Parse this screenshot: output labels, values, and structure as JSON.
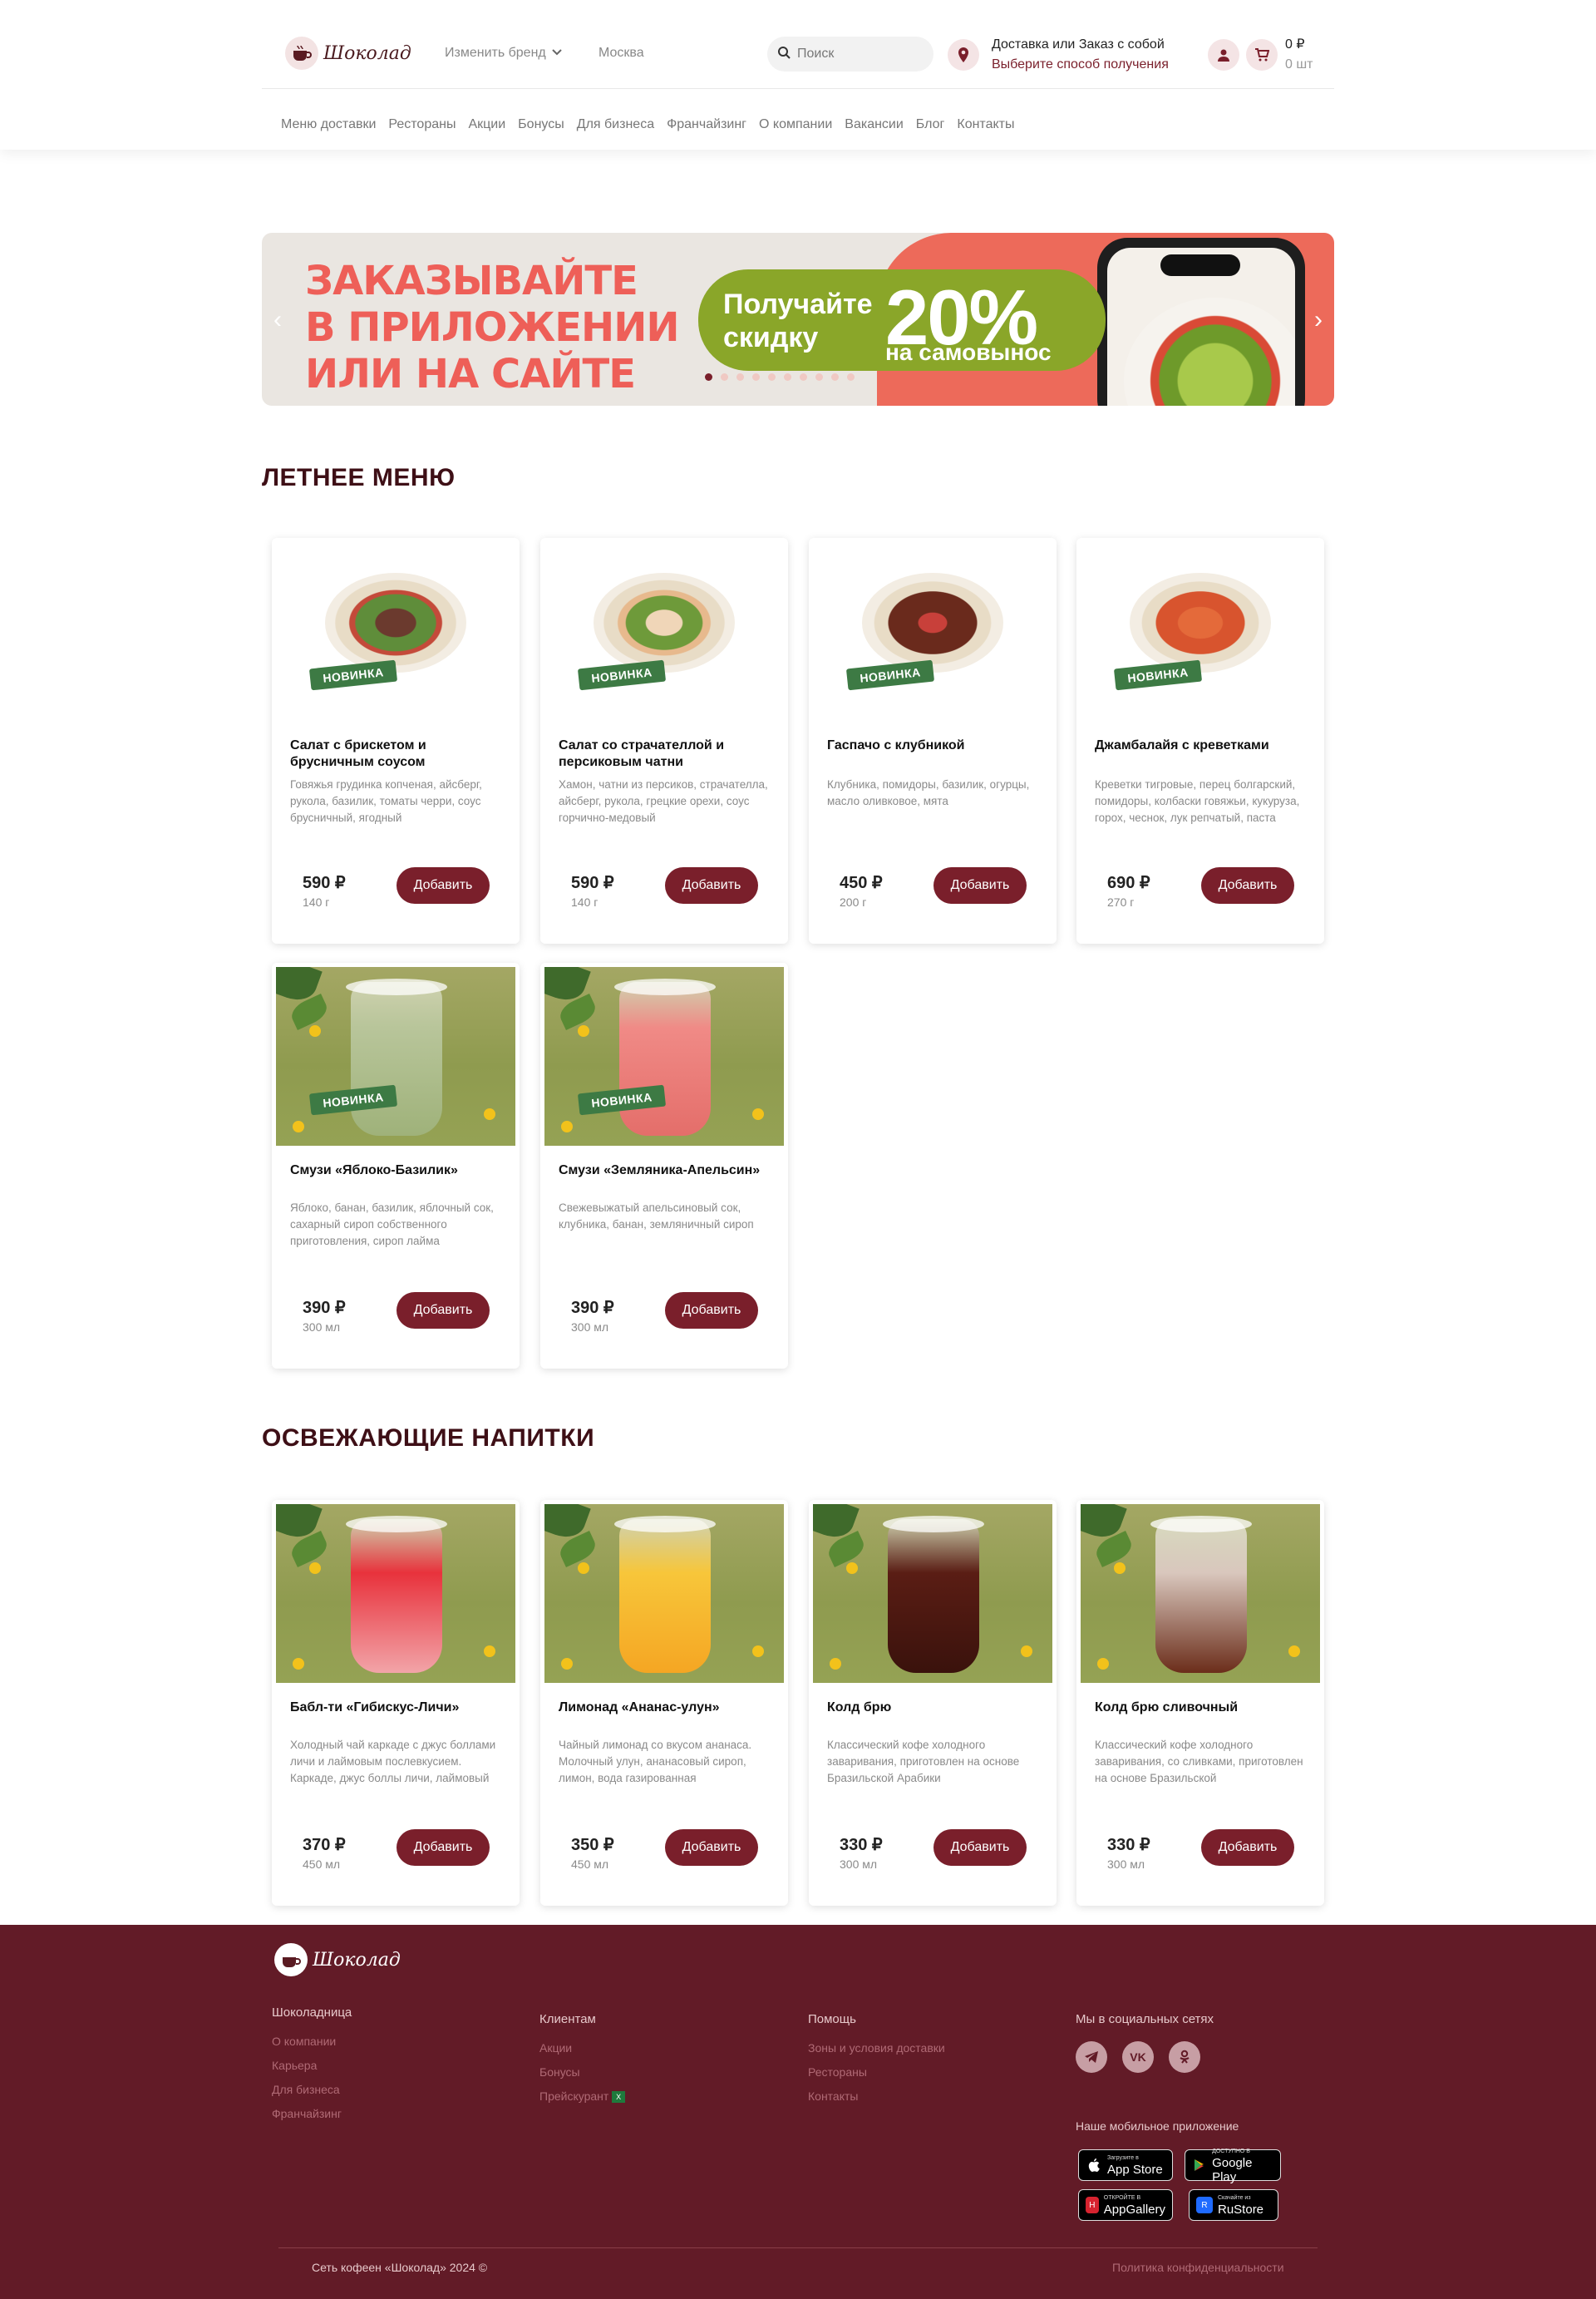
{
  "header": {
    "logo_text": "Шоколад",
    "brand_switch": "Изменить бренд",
    "city": "Москва",
    "search_placeholder": "Поиск",
    "delivery_title": "Доставка или Заказ с собой",
    "delivery_link": "Выберите способ получения",
    "cart_sum": "0 ₽",
    "cart_count": "0 шт",
    "nav": [
      "Меню доставки",
      "Рестораны",
      "Акции",
      "Бонусы",
      "Для бизнеса",
      "Франчайзинг",
      "О компании",
      "Вакансии",
      "Блог",
      "Контакты"
    ]
  },
  "banner": {
    "headline": "ЗАКАЗЫВАЙТЕ\nВ ПРИЛОЖЕНИИ\nИЛИ НА САЙТЕ",
    "promo_text": "Получайте\nскидку",
    "promo_percent": "20%",
    "promo_sub": "на самовынос",
    "slides_total": 10,
    "active_slide": 1,
    "colors": {
      "headline": "#ee5f58",
      "promo": "#8aa629",
      "accent": "#ed6a5a"
    }
  },
  "sections": {
    "summer_title": "ЛЕТНЕЕ МЕНЮ",
    "drinks_title": "ОСВЕЖАЮЩИЕ НАПИТКИ"
  },
  "badge_label": "НОВИНКА",
  "add_label": "Добавить",
  "summer_items": [
    {
      "name": "Салат с брискетом и брусничным соусом",
      "desc": "Говяжья грудинка копченая, айсберг, рукола, базилик, томаты черри, соус брусничный, ягодный",
      "price": "590 ₽",
      "weight": "140 г",
      "new": true
    },
    {
      "name": "Салат со страчателлой и персиковым чатни",
      "desc": "Хамон, чатни из персиков, страчателла, айсберг, рукола, грецкие орехи, соус горчично-медовый",
      "price": "590 ₽",
      "weight": "140 г",
      "new": true
    },
    {
      "name": "Гаспачо с клубникой",
      "desc": "Клубника, помидоры, базилик, огурцы, масло оливковое, мята",
      "price": "450 ₽",
      "weight": "200 г",
      "new": true
    },
    {
      "name": "Джамбалайя с креветками",
      "desc": "Креветки тигровые, перец болгарский, помидоры, колбаски говяжьи, кукуруза, горох, чеснок, лук репчатый, паста",
      "price": "690 ₽",
      "weight": "270 г",
      "new": true
    },
    {
      "name": "Смузи «Яблоко-Базилик»",
      "desc": "Яблоко, банан, базилик, яблочный сок, сахарный сироп собственного приготовления, сироп лайма",
      "price": "390 ₽",
      "weight": "300 мл",
      "new": true
    },
    {
      "name": "Смузи «Земляника-Апельсин»",
      "desc": "Свежевыжатый апельсиновый сок, клубника, банан, земляничный сироп",
      "price": "390 ₽",
      "weight": "300 мл",
      "new": true
    }
  ],
  "drink_items": [
    {
      "name": "Бабл-ти «Гибискус-Личи»",
      "desc": "Холодный чай каркаде с джус боллами личи и лаймовым послевкусием. Каркаде, джус боллы личи, лаймовый",
      "price": "370 ₽",
      "weight": "450 мл"
    },
    {
      "name": "Лимонад «Ананас-улун»",
      "desc": "Чайный лимонад со вкусом ананаса. Молочный улун, ананасовый сироп, лимон, вода газированная",
      "price": "350 ₽",
      "weight": "450 мл"
    },
    {
      "name": "Колд брю",
      "desc": "Классический кофе холодного заваривания, приготовлен на основе Бразильской Арабики",
      "price": "330 ₽",
      "weight": "300 мл"
    },
    {
      "name": "Колд брю сливочный",
      "desc": "Классический кофе холодного заваривания, со сливками, приготовлен на основе Бразильской",
      "price": "330 ₽",
      "weight": "300 мл"
    }
  ],
  "footer": {
    "logo_text": "Шоколад",
    "col1": {
      "title": "Шоколадница",
      "links": [
        "О компании",
        "Карьера",
        "Для бизнеса",
        "Франчайзинг"
      ]
    },
    "col2": {
      "title": "Клиентам",
      "links": [
        "Акции",
        "Бонусы",
        "Прейскурант"
      ]
    },
    "col3": {
      "title": "Помощь",
      "links": [
        "Зоны и условия доставки",
        "Рестораны",
        "Контакты"
      ]
    },
    "social_title": "Мы в социальных сетях",
    "social": [
      "telegram-icon",
      "vk-icon",
      "odnoklassniki-icon"
    ],
    "apps_title": "Наше мобильное приложение",
    "apps": [
      {
        "small": "Загрузите в",
        "big": "App Store"
      },
      {
        "small": "ДОСТУПНО В",
        "big": "Google Play"
      },
      {
        "small": "ОТКРОЙТЕ В",
        "big": "AppGallery"
      },
      {
        "small": "Скачайте из",
        "big": "RuStore"
      }
    ],
    "copyright": "Сеть кофеен «Шоколад» 2024 ©",
    "privacy": "Политика конфиденциальности",
    "bg_color": "#621b27"
  }
}
